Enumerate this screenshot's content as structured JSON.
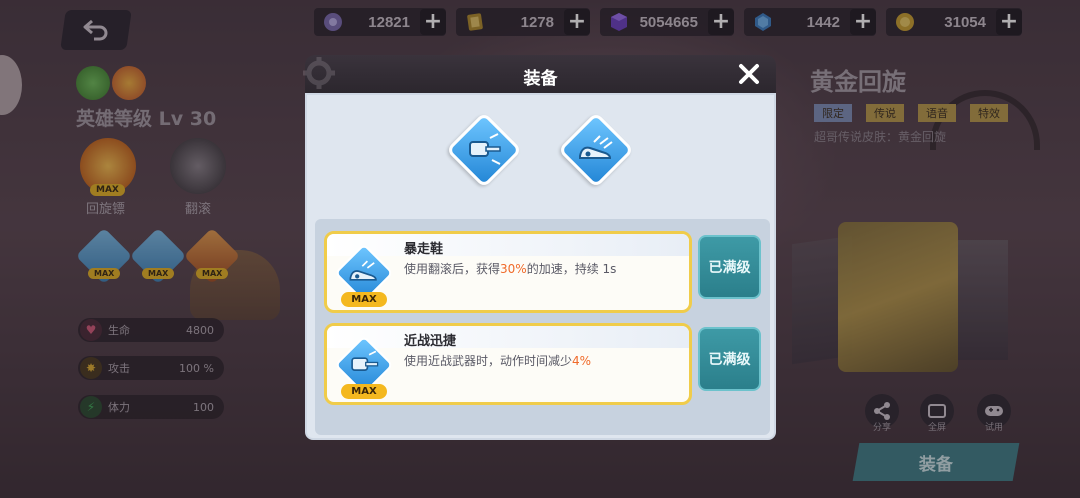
{
  "currencies": [
    {
      "icon": "purple-orb-icon",
      "value": "12821"
    },
    {
      "icon": "card-icon",
      "value": "1278"
    },
    {
      "icon": "purple-cube-icon",
      "value": "5054665"
    },
    {
      "icon": "blue-gem-icon",
      "value": "1442"
    },
    {
      "icon": "gold-coin-icon",
      "value": "31054"
    }
  ],
  "plus_label": "+",
  "hero": {
    "level_text": "英雄等级 Lv 30",
    "skills": [
      {
        "label": "回旋镖",
        "max": "MAX"
      },
      {
        "label": "翻滚"
      }
    ],
    "small_max": "MAX",
    "stats": [
      {
        "name": "生命",
        "value": "4800",
        "color": "#d45a7a"
      },
      {
        "name": "攻击",
        "value": "100 %",
        "color": "#e0b030"
      },
      {
        "name": "体力",
        "value": "100",
        "color": "#3fae5a"
      }
    ]
  },
  "skin": {
    "title": "黄金回旋",
    "tags": [
      "限定",
      "传说",
      "语音",
      "特效"
    ],
    "desc": "超哥传说皮肤：黄金回旋",
    "actions": [
      {
        "label": "分享",
        "icon": "share-icon"
      },
      {
        "label": "全屏",
        "icon": "fullscreen-icon"
      },
      {
        "label": "试用",
        "icon": "gamepad-icon"
      }
    ],
    "equip_label": "装备"
  },
  "modal": {
    "title": "装备",
    "items": [
      {
        "name": "暴走鞋",
        "desc_pre": "使用翻滚后，获得",
        "desc_hl": "30%",
        "desc_post": "的加速，持续 1s",
        "max": "MAX",
        "button": "已满级"
      },
      {
        "name": "近战迅捷",
        "desc_pre": "使用近战武器时，动作时间减少",
        "desc_hl": "4%",
        "desc_post": "",
        "max": "MAX",
        "button": "已满级"
      }
    ]
  },
  "colors": {
    "accent_teal": "#2b7f8b",
    "highlight_orange": "#f06a2a",
    "max_gold": "#f4b81f"
  }
}
